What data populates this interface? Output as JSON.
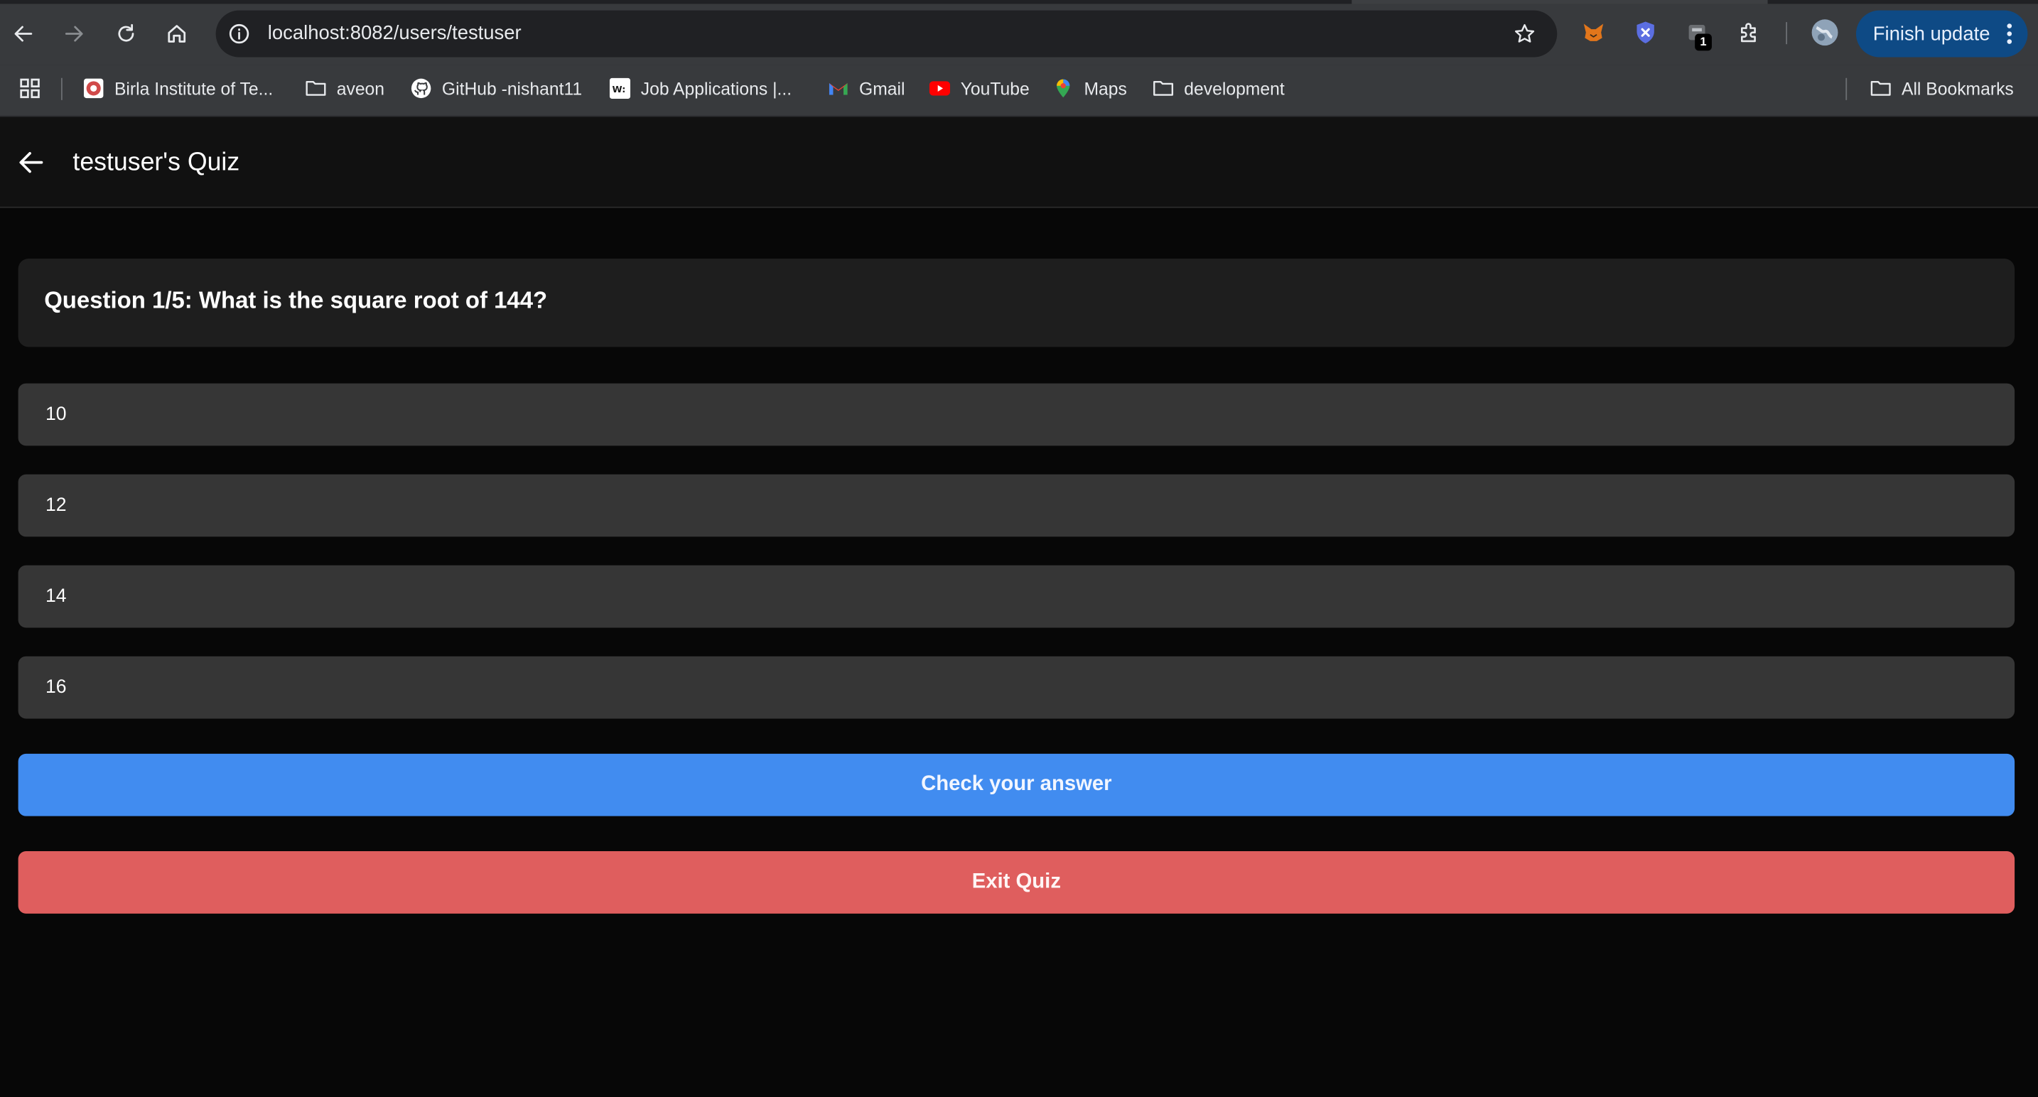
{
  "browser": {
    "url": "localhost:8082/users/testuser",
    "finish_update_label": "Finish update",
    "extension_badge": "1",
    "bookmarks": [
      {
        "label": "Birla Institute of Te...",
        "icon": "bits-logo-icon"
      },
      {
        "label": "aveon",
        "icon": "folder-icon"
      },
      {
        "label": "GitHub -nishant11",
        "icon": "github-icon"
      },
      {
        "label": "Job Applications |...",
        "icon": "workday-icon"
      },
      {
        "label": "Gmail",
        "icon": "gmail-icon"
      },
      {
        "label": "YouTube",
        "icon": "youtube-icon"
      },
      {
        "label": "Maps",
        "icon": "maps-icon"
      },
      {
        "label": "development",
        "icon": "folder-icon"
      }
    ],
    "all_bookmarks_label": "All Bookmarks"
  },
  "app": {
    "title": "testuser's Quiz"
  },
  "quiz": {
    "question": "Question 1/5: What is the square root of 144?",
    "options": [
      "10",
      "12",
      "14",
      "16"
    ],
    "check_label": "Check your answer",
    "exit_label": "Exit Quiz"
  },
  "colors": {
    "check_button": "#418cf0",
    "exit_button": "#df5e5e",
    "option_bg": "#363636",
    "page_bg": "#070707"
  }
}
